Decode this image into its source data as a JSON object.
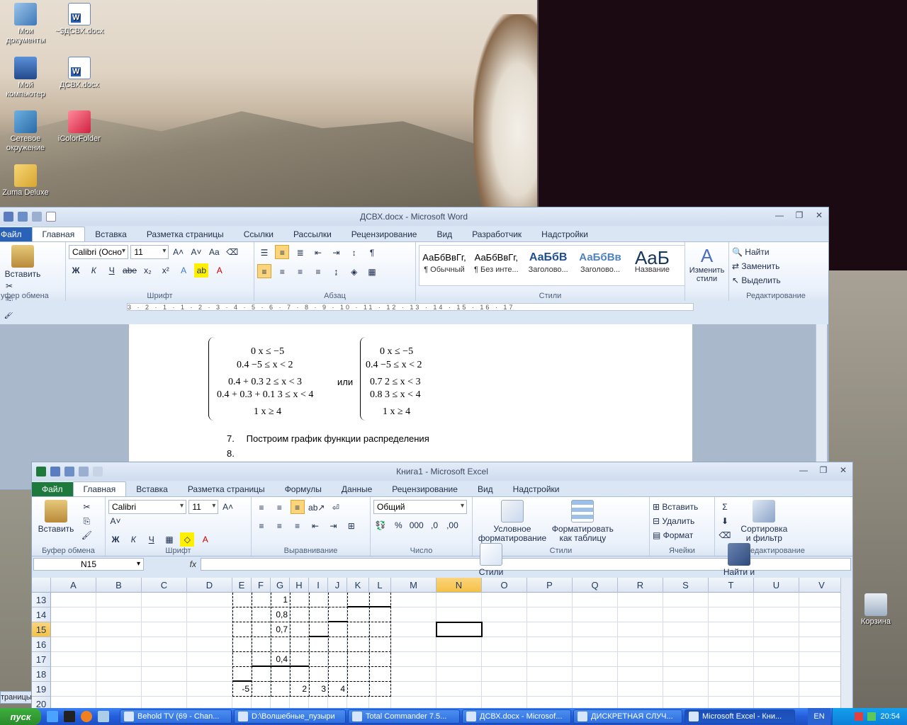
{
  "desktop": {
    "icons": [
      {
        "label": "Мои документы"
      },
      {
        "label": "~$ДСВХ.docx"
      },
      {
        "label": "Мой компьютер"
      },
      {
        "label": "ДСВХ.docx"
      },
      {
        "label": "Сетевое окружение"
      },
      {
        "label": "iColorFolder"
      },
      {
        "label": "Zuma Deluxe"
      },
      {
        "label": "Корзина"
      }
    ]
  },
  "word": {
    "title": "ДСВХ.docx - Microsoft Word",
    "tabs": [
      "Файл",
      "Главная",
      "Вставка",
      "Разметка страницы",
      "Ссылки",
      "Рассылки",
      "Рецензирование",
      "Вид",
      "Разработчик",
      "Надстройки"
    ],
    "clipboard": {
      "paste": "Вставить",
      "group": "уфер обмена"
    },
    "font": {
      "name": "Calibri (Осно",
      "size": "11",
      "group": "Шрифт",
      "bold": "Ж",
      "italic": "К",
      "underline": "Ч",
      "strike": "abe",
      "sub": "x₂",
      "sup": "x²",
      "case": "Aa"
    },
    "paragraph": {
      "group": "Абзац"
    },
    "styles": {
      "group": "Стили",
      "items": [
        {
          "preview": "АаБбВвГг,",
          "name": "¶ Обычный"
        },
        {
          "preview": "АаБбВвГг,",
          "name": "¶ Без инте..."
        },
        {
          "preview": "АаБбВ",
          "name": "Заголово..."
        },
        {
          "preview": "АаБбВв",
          "name": "Заголово..."
        },
        {
          "preview": "AaБ",
          "name": "Название"
        }
      ],
      "change": "Изменить стили"
    },
    "editing": {
      "group": "Редактирование",
      "find": "Найти",
      "replace": "Заменить",
      "select": "Выделить"
    },
    "ruler": "3 · 2 · 1 · 1 · 2 · 3 · 4 · 5 · 6 · 7 · 8 · 9 · 10 · 11 · 12 · 13 · 14 · 15 · 16 · 17",
    "math_left": [
      {
        "text": "0    x ≤ −5"
      },
      {
        "text": "0.4   −5 ≤ x < 2"
      },
      {
        "text": "0.4 + 0.3   2 ≤ x < 3"
      },
      {
        "text": "0.4 + 0.3 + 0.1   3 ≤ x < 4"
      },
      {
        "text": "1    x ≥ 4"
      }
    ],
    "or": "или",
    "math_right": [
      {
        "text": "0    x ≤ −5"
      },
      {
        "text": "0.4   −5 ≤ x < 2"
      },
      {
        "text": "0.7   2 ≤ x < 3"
      },
      {
        "text": "0.8   3 ≤ x < 4"
      },
      {
        "text": "1    x ≥ 4"
      }
    ],
    "list": [
      {
        "num": "7.",
        "text": "Построим график функции распределения"
      },
      {
        "num": "8.",
        "text": ""
      }
    ]
  },
  "excel": {
    "title": "Книга1  -  Microsoft Excel",
    "tabs": [
      "Файл",
      "Главная",
      "Вставка",
      "Разметка страницы",
      "Формулы",
      "Данные",
      "Рецензирование",
      "Вид",
      "Надстройки"
    ],
    "clipboard": {
      "paste": "Вставить",
      "group": "Буфер обмена"
    },
    "font": {
      "name": "Calibri",
      "size": "11",
      "group": "Шрифт",
      "bold": "Ж",
      "italic": "К",
      "underline": "Ч"
    },
    "alignment": {
      "group": "Выравнивание"
    },
    "number": {
      "format": "Общий",
      "group": "Число",
      "percent": "%",
      "thousands": "000"
    },
    "styles": {
      "group": "Стили",
      "cond": "Условное форматирование",
      "table": "Форматировать как таблицу",
      "cell": "Стили ячеек"
    },
    "cells": {
      "group": "Ячейки",
      "insert": "Вставить",
      "delete": "Удалить",
      "format": "Формат"
    },
    "editing": {
      "group": "Редактирование",
      "sort": "Сортировка и фильтр",
      "find": "Найти и выделить",
      "sigma": "Σ"
    },
    "namebox": "N15",
    "fx": "fx",
    "columns": [
      "A",
      "B",
      "C",
      "D",
      "E",
      "F",
      "G",
      "H",
      "I",
      "J",
      "K",
      "L",
      "M",
      "N",
      "O",
      "P",
      "Q",
      "R",
      "S",
      "T",
      "U",
      "V"
    ],
    "rows": [
      "13",
      "14",
      "15",
      "16",
      "17",
      "18",
      "19",
      "20"
    ],
    "selected_column": "N",
    "selected_row": "15",
    "cells_values": {
      "g13": "1",
      "g14": "0,8",
      "g15": "0,7",
      "g17": "0,4",
      "e19": "-5",
      "h19": "2",
      "i19": "3",
      "j19": "4"
    }
  },
  "taskbar": {
    "start": "пуск",
    "buttons": [
      {
        "label": "Behold TV (69 - Chan..."
      },
      {
        "label": "D:\\Волшебные_пузыри"
      },
      {
        "label": "Total Commander 7.5..."
      },
      {
        "label": "ДСВХ.docx - Microsof..."
      },
      {
        "label": "ДИСКРЕТНАЯ СЛУЧ..."
      },
      {
        "label": "Microsoft Excel - Кни..."
      }
    ],
    "lang": "EN",
    "time": "20:54"
  },
  "left_strip_label": "траницы"
}
